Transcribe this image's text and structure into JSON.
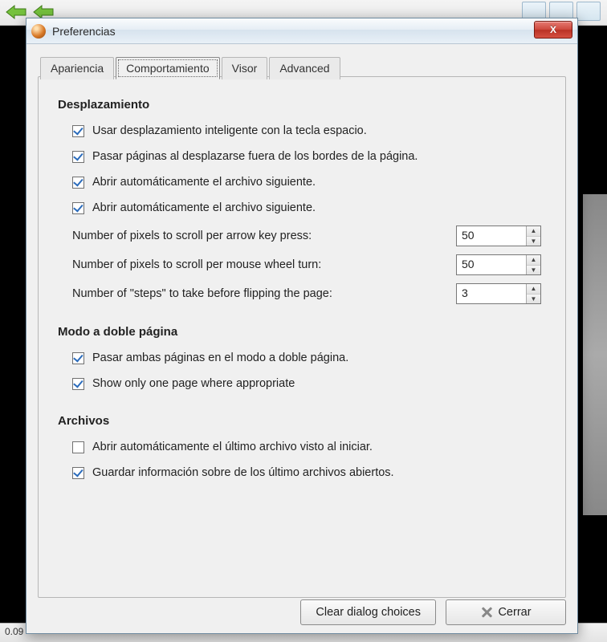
{
  "background": {
    "status_text": "0.09"
  },
  "dialog": {
    "title": "Preferencias",
    "close_glyph": "X",
    "tabs": {
      "apariencia": "Apariencia",
      "comportamiento": "Comportamiento",
      "visor": "Visor",
      "advanced": "Advanced"
    },
    "sections": {
      "desplazamiento": {
        "heading": "Desplazamiento",
        "smart_scroll": "Usar desplazamiento inteligente con la tecla espacio.",
        "flip_outside": "Pasar páginas al desplazarse fuera de los bordes de la página.",
        "auto_open_next_1": "Abrir automáticamente el archivo siguiente.",
        "auto_open_next_2": "Abrir automáticamente el archivo siguiente.",
        "px_arrow_label": "Number of pixels to scroll per arrow key press:",
        "px_arrow_value": "50",
        "px_wheel_label": "Number of pixels to scroll per mouse wheel turn:",
        "px_wheel_value": "50",
        "steps_label": "Number of \"steps\" to take before flipping the page:",
        "steps_value": "3"
      },
      "doble": {
        "heading": "Modo a doble página",
        "flip_both": "Pasar ambas páginas en el modo a doble página.",
        "one_page": "Show only one page where appropriate"
      },
      "archivos": {
        "heading": "Archivos",
        "open_last": "Abrir automáticamente el último archivo visto al iniciar.",
        "save_info": "Guardar información sobre de los último archivos abiertos."
      }
    },
    "buttons": {
      "clear": "Clear dialog choices",
      "close": "Cerrar"
    }
  }
}
